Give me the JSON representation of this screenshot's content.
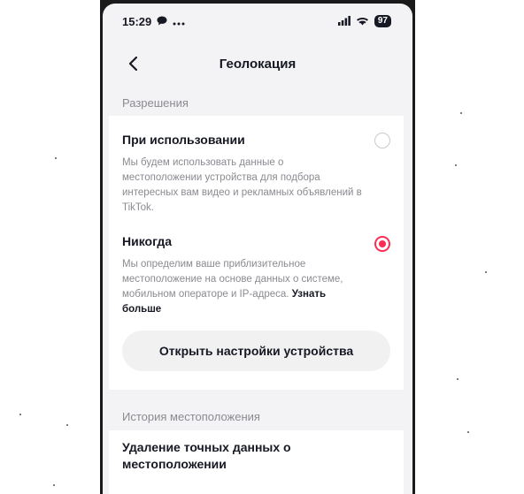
{
  "status_bar": {
    "time": "15:29",
    "battery": "97"
  },
  "header": {
    "title": "Геолокация"
  },
  "permissions": {
    "section_label": "Разрешения",
    "options": [
      {
        "title": "При использовании",
        "description": "Мы будем использовать данные о местоположении устройства для подбора интересных вам видео и рекламных объявлений в TikTok.",
        "selected": false
      },
      {
        "title": "Никогда",
        "description": "Мы определим ваше приблизительное местоположение на основе данных о системе, мобильном операторе и IP-адреса.",
        "learn_more": "Узнать больше",
        "selected": true
      }
    ],
    "device_settings_button": "Открыть настройки устройства"
  },
  "history": {
    "section_label": "История местоположения",
    "delete_item": "Удаление точных данных о местоположении"
  },
  "colors": {
    "accent": "#fe2c55",
    "background": "#f3f3f5",
    "text_primary": "#161823",
    "text_secondary": "#8a8b91"
  }
}
